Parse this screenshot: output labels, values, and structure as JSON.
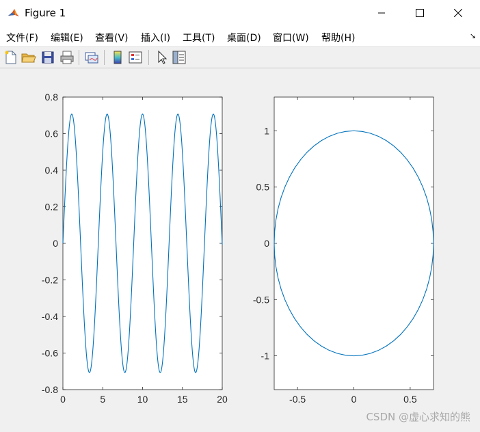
{
  "window": {
    "title": "Figure 1"
  },
  "menu": [
    "文件(F)",
    "编辑(E)",
    "查看(V)",
    "插入(I)",
    "工具(T)",
    "桌面(D)",
    "窗口(W)",
    "帮助(H)"
  ],
  "toolbar_icons": [
    "new-figure-icon",
    "open-file-icon",
    "save-icon",
    "print-icon",
    "link-plot-icon",
    "colorbar-icon",
    "legend-icon",
    "pointer-icon",
    "property-inspector-icon"
  ],
  "colors": {
    "line": "#0072bd",
    "axes_bg": "#ffffff",
    "figure_bg": "#f0f0f0"
  },
  "watermark": "CSDN @虚心求知的熊",
  "chart_data": [
    {
      "type": "line",
      "function": "0.707*sin(sqrt(2)*x)",
      "amplitude": 0.707,
      "frequency": 1.41421,
      "x_range": [
        0,
        20
      ],
      "xlim": [
        0,
        20
      ],
      "ylim": [
        -0.8,
        0.8
      ],
      "xticks": [
        0,
        5,
        10,
        15,
        20
      ],
      "yticks": [
        -0.8,
        -0.6,
        -0.4,
        -0.2,
        0,
        0.2,
        0.4,
        0.6,
        0.8
      ],
      "xtick_labels": [
        "0",
        "5",
        "10",
        "15",
        "20"
      ],
      "ytick_labels": [
        "-0.8",
        "-0.6",
        "-0.4",
        "-0.2",
        "0",
        "0.2",
        "0.4",
        "0.6",
        "0.8"
      ],
      "grid": false,
      "title": "",
      "xlabel": "",
      "ylabel": ""
    },
    {
      "type": "line",
      "shape": "ellipse",
      "x_semi_axis": 0.707,
      "y_semi_axis": 1.0,
      "xlim": [
        -0.707,
        0.707
      ],
      "ylim": [
        -1.3,
        1.3
      ],
      "xticks": [
        -0.5,
        0,
        0.5
      ],
      "yticks": [
        -1,
        -0.5,
        0,
        0.5,
        1
      ],
      "xtick_labels": [
        "-0.5",
        "0",
        "0.5"
      ],
      "ytick_labels": [
        "-1",
        "-0.5",
        "0",
        "0.5",
        "1"
      ],
      "grid": false,
      "title": "",
      "xlabel": "",
      "ylabel": ""
    }
  ]
}
